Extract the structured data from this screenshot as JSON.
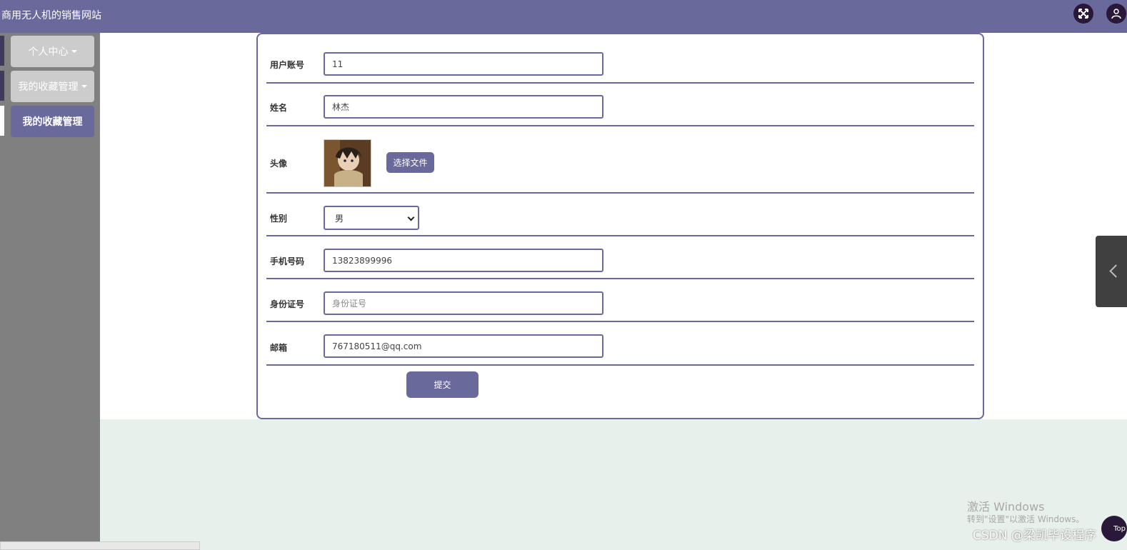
{
  "header": {
    "title": "商用无人机的销售网站",
    "fullscreen_icon": "expand-icon",
    "user_icon": "user-icon"
  },
  "sidebar": {
    "items": [
      {
        "label": "个人中心",
        "state": "collapsed"
      },
      {
        "label": "我的收藏管理",
        "state": "collapsed"
      },
      {
        "label": "我的收藏管理",
        "state": "active"
      }
    ]
  },
  "form": {
    "account": {
      "label": "用户账号",
      "value": "11"
    },
    "name": {
      "label": "姓名",
      "value": "林杰"
    },
    "avatar": {
      "label": "头像",
      "button": "选择文件"
    },
    "gender": {
      "label": "性别",
      "value": "男"
    },
    "phone": {
      "label": "手机号码",
      "value": "13823899996"
    },
    "idcard": {
      "label": "身份证号",
      "placeholder": "身份证号"
    },
    "email": {
      "label": "邮箱",
      "value": "767180511@qq.com"
    },
    "submit": "提交"
  },
  "overlay": {
    "watermark_line1": "激活 Windows",
    "watermark_line2": "转到\"设置\"以激活 Windows。",
    "csdn": "CSDN @梁凯毕设程序",
    "top_button": "Top"
  },
  "colors": {
    "accent": "#69699b",
    "sidebar": "#808080",
    "page_bg": "#e8f0eb"
  }
}
